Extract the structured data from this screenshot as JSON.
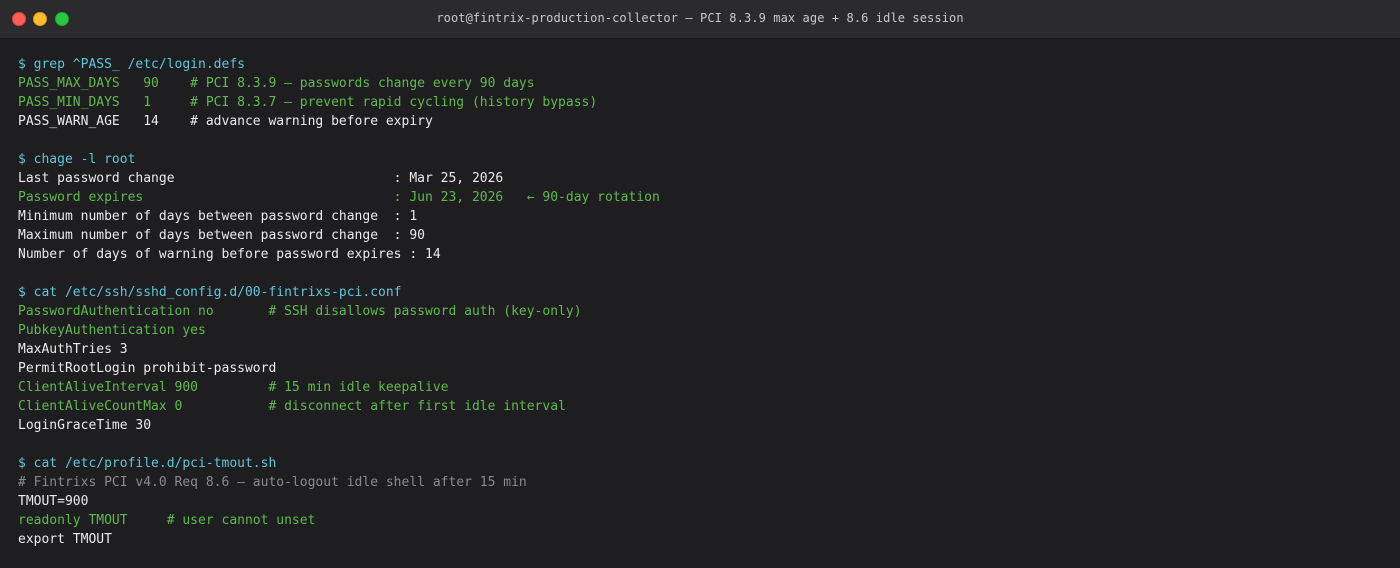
{
  "window": {
    "title": "root@fintrix-production-collector — PCI 8.3.9 max age + 8.6 idle session"
  },
  "colors": {
    "command": "#5fc6d8",
    "highlight": "#5fba4d",
    "normal": "#ebebeb",
    "comment": "#8b8b8f"
  },
  "terminal": {
    "lines": [
      {
        "style": "cmd",
        "text": "$ grep ^PASS_ /etc/login.defs"
      },
      {
        "style": "green",
        "text": "PASS_MAX_DAYS   90    # PCI 8.3.9 — passwords change every 90 days"
      },
      {
        "style": "green",
        "text": "PASS_MIN_DAYS   1     # PCI 8.3.7 — prevent rapid cycling (history bypass)"
      },
      {
        "style": "white",
        "text": "PASS_WARN_AGE   14    # advance warning before expiry"
      },
      {
        "style": "white",
        "text": ""
      },
      {
        "style": "cmd",
        "text": "$ chage -l root"
      },
      {
        "style": "white",
        "text": "Last password change                            : Mar 25, 2026"
      },
      {
        "style": "green",
        "text": "Password expires                                : Jun 23, 2026   ← 90-day rotation"
      },
      {
        "style": "white",
        "text": "Minimum number of days between password change  : 1"
      },
      {
        "style": "white",
        "text": "Maximum number of days between password change  : 90"
      },
      {
        "style": "white",
        "text": "Number of days of warning before password expires : 14"
      },
      {
        "style": "white",
        "text": ""
      },
      {
        "style": "cmd",
        "text": "$ cat /etc/ssh/sshd_config.d/00-fintrixs-pci.conf"
      },
      {
        "style": "green",
        "text": "PasswordAuthentication no       # SSH disallows password auth (key-only)"
      },
      {
        "style": "green",
        "text": "PubkeyAuthentication yes"
      },
      {
        "style": "white",
        "text": "MaxAuthTries 3"
      },
      {
        "style": "white",
        "text": "PermitRootLogin prohibit-password"
      },
      {
        "style": "green",
        "text": "ClientAliveInterval 900         # 15 min idle keepalive"
      },
      {
        "style": "green",
        "text": "ClientAliveCountMax 0           # disconnect after first idle interval"
      },
      {
        "style": "white",
        "text": "LoginGraceTime 30"
      },
      {
        "style": "white",
        "text": ""
      },
      {
        "style": "cmd",
        "text": "$ cat /etc/profile.d/pci-tmout.sh"
      },
      {
        "style": "gray",
        "text": "# Fintrixs PCI v4.0 Req 8.6 — auto-logout idle shell after 15 min"
      },
      {
        "style": "white",
        "text": "TMOUT=900"
      },
      {
        "style": "green",
        "text": "readonly TMOUT     # user cannot unset"
      },
      {
        "style": "white",
        "text": "export TMOUT"
      }
    ]
  }
}
